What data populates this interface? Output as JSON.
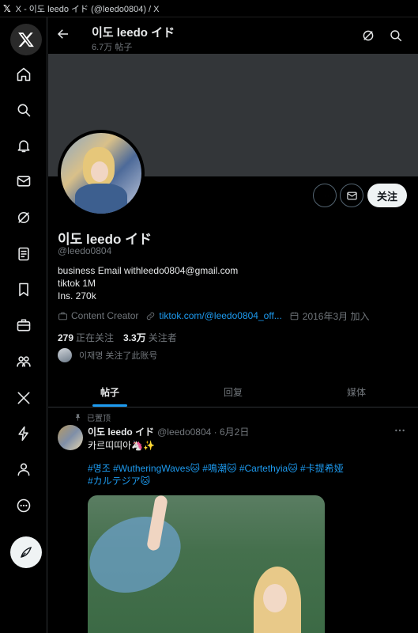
{
  "window": {
    "title": "X - 이도 leedo イド (@leedo0804) / X"
  },
  "header": {
    "name": "이도 leedo イド",
    "post_count": "6.7万 帖子"
  },
  "profile": {
    "name": "이도 leedo イド",
    "handle": "@leedo0804",
    "bio": [
      "business Email withleedo0804@gmail.com",
      "tiktok 1M",
      "Ins. 270k"
    ],
    "category": "Content Creator",
    "link": "tiktok.com/@leedo0804_off...",
    "joined": "2016年3月 加入",
    "following_count": "279",
    "following_label": "正在关注",
    "followers_count": "3.3万",
    "followers_label": "关注者",
    "followed_by": "이재명 关注了此账号",
    "follow_label": "关注"
  },
  "tabs": [
    {
      "label": "帖子",
      "active": true
    },
    {
      "label": "回复",
      "active": false
    },
    {
      "label": "媒体",
      "active": false
    }
  ],
  "post": {
    "pinned_label": "已置顶",
    "author": "이도 leedo イド",
    "meta": "@leedo0804 · 6月2日",
    "text": "카르띠띠아🦄✨",
    "tags": [
      "#명조 #WutheringWaves🐱 #鳴潮🐱 #Cartethyia🐱 #卡提希娅",
      "#カルテジア🐱"
    ]
  },
  "colors": {
    "accent": "#1d9bf0",
    "background": "#000000",
    "banner": "#333639",
    "muted_text": "#71767b"
  },
  "icons": [
    "x-logo-icon",
    "home-icon",
    "search-icon",
    "bell-icon",
    "mail-icon",
    "grok-icon",
    "list-icon",
    "bookmark-icon",
    "briefcase-icon",
    "communities-icon",
    "x-premium-icon",
    "lightning-icon",
    "profile-icon",
    "more-icon",
    "compose-icon"
  ]
}
